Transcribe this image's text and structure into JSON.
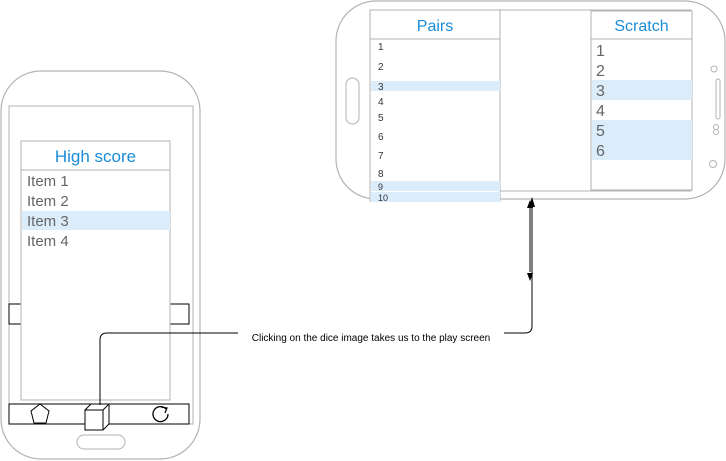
{
  "portrait_phone": {
    "list_title": "High score",
    "items": [
      "Item 1",
      "Item 2",
      "Item 3",
      "Item 4"
    ],
    "selected_index": 2,
    "toolbar_icons": [
      "pentagon-icon",
      "dice-icon",
      "refresh-icon"
    ]
  },
  "landscape_phone": {
    "pairs": {
      "title": "Pairs",
      "items": [
        "1",
        "2",
        "3",
        "4",
        "5",
        "6",
        "7",
        "8",
        "9",
        "10"
      ],
      "highlighted_indices": [
        2,
        8,
        9
      ]
    },
    "scratch": {
      "title": "Scratch",
      "items": [
        "1",
        "2",
        "3",
        "4",
        "5",
        "6"
      ],
      "highlighted_indices": [
        2,
        4,
        5
      ]
    }
  },
  "connector": {
    "label": "Clicking on the dice image takes us to the play screen"
  },
  "colors": {
    "outline": "#b3b3b3",
    "title_blue": "#1a8cd8",
    "highlight": "#dbecfb",
    "item_text": "#666666",
    "line": "#000000"
  }
}
